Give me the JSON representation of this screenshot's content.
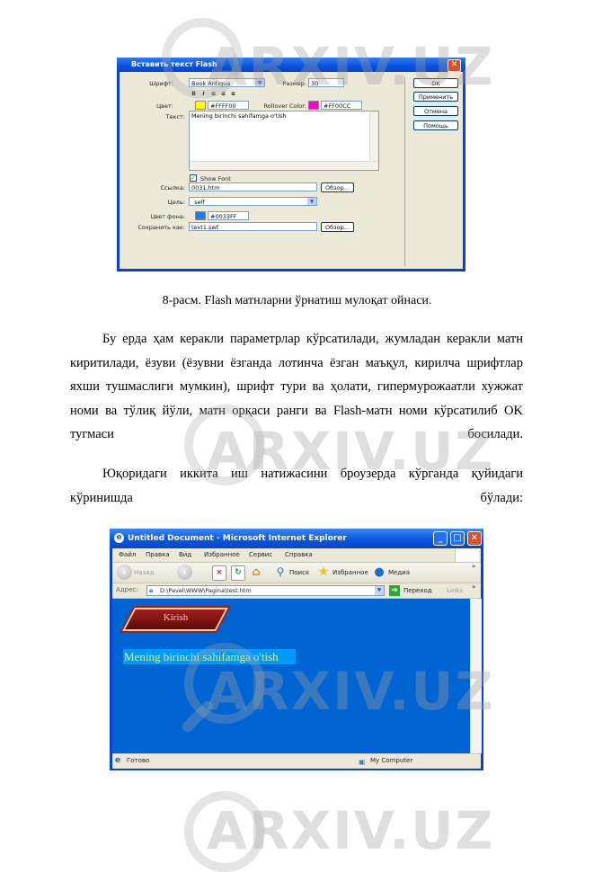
{
  "dialog": {
    "title": "Вставить текст Flash",
    "font_label": "Шрифт:",
    "font_value": "Book Antiqua",
    "size_label": "Размер:",
    "size_value": "30",
    "format_buttons": [
      "B",
      "I",
      "≡",
      "≡",
      "≡"
    ],
    "color_label": "Цвет:",
    "color_value": "#FFFF00",
    "color_swatch": "#ffff00",
    "rollover_label": "Rollover Color:",
    "rollover_value": "#FF00CC",
    "rollover_swatch": "#ff00cc",
    "text_label": "Текст:",
    "text_value": "Mening birinchi sahifamga o'tish",
    "show_font_label": "Show Font",
    "show_font_checked": true,
    "link_label": "Ссылка:",
    "link_value": "0031.htm",
    "browse_label": "Обзор...",
    "target_label": "Цель:",
    "target_value": "_self",
    "bg_label": "Цвет фона:",
    "bg_value": "#0033FF",
    "bg_swatch": "#1f7fe0",
    "saveas_label": "Сохранить как:",
    "saveas_value": "text1.swf",
    "browse2_label": "Обзор...",
    "buttons": {
      "ok": "OK",
      "apply": "Применить",
      "cancel": "Отмена",
      "help": "Помощь"
    }
  },
  "document": {
    "caption": "8-расм. Flash матнларни ўрнатиш мулоқат ойнаси.",
    "paragraph1": "Бу ерда ҳам керакли параметрлар кўрсатилади, жумладан керакли матн киритилади, ёзуви (ёзувни ёзганда лотинча ёзган маъқул, кирилча шрифтлар яхши тушмаслиги мумкин), шрифт тури ва ҳолати, гипермурожаатли хужжат номи ва тўлиқ йўли, матн орқаси ранги ва Flash-матн номи кўрсатилиб OK тугмаси босилади.",
    "paragraph2": "Юқоридаги иккита иш натижасини броузерда кўрганда қуйидаги кўринишда бўлади:"
  },
  "browser": {
    "title": "Untitled Document - Microsoft Internet Explorer",
    "menu": [
      "Файл",
      "Правка",
      "Вид",
      "Избранное",
      "Сервис",
      "Справка"
    ],
    "toolbar": {
      "back": "Назад",
      "search": "Поиск",
      "favorites": "Избранное",
      "media": "Медиа"
    },
    "address_label": "Адрес:",
    "address_value": "D:\\Pavel\\WWW\\Pagina\\test.htm",
    "go_label": "Переход",
    "links_label": "Links",
    "page": {
      "button_label": "Kirish",
      "link_text": "Mening birinchi sahifamga o'tish"
    },
    "status_text": "Готово",
    "zone_text": "My Computer"
  },
  "watermark": "ARXIV.UZ"
}
